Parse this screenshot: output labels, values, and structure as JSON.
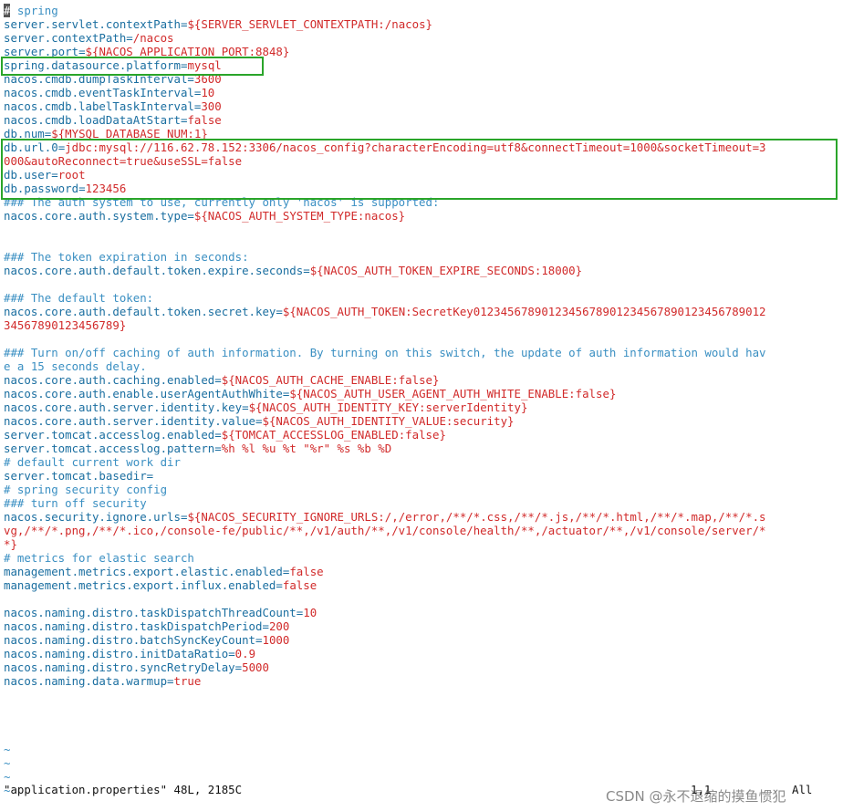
{
  "editor": {
    "lines": [
      [
        {
          "t": "#",
          "c": "cur"
        },
        {
          "t": " spring",
          "c": "c"
        }
      ],
      [
        {
          "t": "server.servlet.contextPath",
          "c": "k"
        },
        {
          "t": "=",
          "c": "k"
        },
        {
          "t": "${SERVER_SERVLET_CONTEXTPATH:/nacos}",
          "c": "v"
        }
      ],
      [
        {
          "t": "server.contextPath",
          "c": "k"
        },
        {
          "t": "=",
          "c": "k"
        },
        {
          "t": "/nacos",
          "c": "v"
        }
      ],
      [
        {
          "t": "server.port",
          "c": "k"
        },
        {
          "t": "=",
          "c": "k"
        },
        {
          "t": "${NACOS_APPLICATION_PORT:8848}",
          "c": "v"
        }
      ],
      [
        {
          "t": "spring.datasource.platform",
          "c": "k"
        },
        {
          "t": "=",
          "c": "k"
        },
        {
          "t": "mysql",
          "c": "v"
        }
      ],
      [
        {
          "t": "nacos.cmdb.dumpTaskInterval",
          "c": "k"
        },
        {
          "t": "=",
          "c": "k"
        },
        {
          "t": "3600",
          "c": "v"
        }
      ],
      [
        {
          "t": "nacos.cmdb.eventTaskInterval",
          "c": "k"
        },
        {
          "t": "=",
          "c": "k"
        },
        {
          "t": "10",
          "c": "v"
        }
      ],
      [
        {
          "t": "nacos.cmdb.labelTaskInterval",
          "c": "k"
        },
        {
          "t": "=",
          "c": "k"
        },
        {
          "t": "300",
          "c": "v"
        }
      ],
      [
        {
          "t": "nacos.cmdb.loadDataAtStart",
          "c": "k"
        },
        {
          "t": "=",
          "c": "k"
        },
        {
          "t": "false",
          "c": "v"
        }
      ],
      [
        {
          "t": "db.num",
          "c": "k"
        },
        {
          "t": "=",
          "c": "k"
        },
        {
          "t": "${MYSQL_DATABASE_NUM:1}",
          "c": "v"
        }
      ],
      [
        {
          "t": "db.url.0",
          "c": "k"
        },
        {
          "t": "=",
          "c": "k"
        },
        {
          "t": "jdbc:mysql://116.62.78.152:3306/nacos_config?characterEncoding=utf8&connectTimeout=1000&socketTimeout=3",
          "c": "v"
        }
      ],
      [
        {
          "t": "000&autoReconnect=true&useSSL=false",
          "c": "v"
        }
      ],
      [
        {
          "t": "db.user",
          "c": "k"
        },
        {
          "t": "=",
          "c": "k"
        },
        {
          "t": "root",
          "c": "v"
        }
      ],
      [
        {
          "t": "db.password",
          "c": "k"
        },
        {
          "t": "=",
          "c": "k"
        },
        {
          "t": "123456",
          "c": "v"
        }
      ],
      [
        {
          "t": "### The auth system to use, currently only 'nacos' is supported:",
          "c": "c"
        }
      ],
      [
        {
          "t": "nacos.core.auth.system.type",
          "c": "k"
        },
        {
          "t": "=",
          "c": "k"
        },
        {
          "t": "${NACOS_AUTH_SYSTEM_TYPE:nacos}",
          "c": "v"
        }
      ],
      [],
      [],
      [
        {
          "t": "### The token expiration in seconds:",
          "c": "c"
        }
      ],
      [
        {
          "t": "nacos.core.auth.default.token.expire.seconds",
          "c": "k"
        },
        {
          "t": "=",
          "c": "k"
        },
        {
          "t": "${NACOS_AUTH_TOKEN_EXPIRE_SECONDS:18000}",
          "c": "v"
        }
      ],
      [],
      [
        {
          "t": "### The default token:",
          "c": "c"
        }
      ],
      [
        {
          "t": "nacos.core.auth.default.token.secret.key",
          "c": "k"
        },
        {
          "t": "=",
          "c": "k"
        },
        {
          "t": "${NACOS_AUTH_TOKEN:SecretKey0123456789012345678901234567890123456789012",
          "c": "v"
        }
      ],
      [
        {
          "t": "34567890123456789}",
          "c": "v"
        }
      ],
      [],
      [
        {
          "t": "### Turn on/off caching of auth information. By turning on this switch, the update of auth information would hav",
          "c": "c"
        }
      ],
      [
        {
          "t": "e a 15 seconds delay.",
          "c": "c"
        }
      ],
      [
        {
          "t": "nacos.core.auth.caching.enabled",
          "c": "k"
        },
        {
          "t": "=",
          "c": "k"
        },
        {
          "t": "${NACOS_AUTH_CACHE_ENABLE:false}",
          "c": "v"
        }
      ],
      [
        {
          "t": "nacos.core.auth.enable.userAgentAuthWhite",
          "c": "k"
        },
        {
          "t": "=",
          "c": "k"
        },
        {
          "t": "${NACOS_AUTH_USER_AGENT_AUTH_WHITE_ENABLE:false}",
          "c": "v"
        }
      ],
      [
        {
          "t": "nacos.core.auth.server.identity.key",
          "c": "k"
        },
        {
          "t": "=",
          "c": "k"
        },
        {
          "t": "${NACOS_AUTH_IDENTITY_KEY:serverIdentity}",
          "c": "v"
        }
      ],
      [
        {
          "t": "nacos.core.auth.server.identity.value",
          "c": "k"
        },
        {
          "t": "=",
          "c": "k"
        },
        {
          "t": "${NACOS_AUTH_IDENTITY_VALUE:security}",
          "c": "v"
        }
      ],
      [
        {
          "t": "server.tomcat.accesslog.enabled",
          "c": "k"
        },
        {
          "t": "=",
          "c": "k"
        },
        {
          "t": "${TOMCAT_ACCESSLOG_ENABLED:false}",
          "c": "v"
        }
      ],
      [
        {
          "t": "server.tomcat.accesslog.pattern",
          "c": "k"
        },
        {
          "t": "=",
          "c": "k"
        },
        {
          "t": "%h %l %u %t \"%r\" %s %b %D",
          "c": "v"
        }
      ],
      [
        {
          "t": "# default current work dir",
          "c": "c"
        }
      ],
      [
        {
          "t": "server.tomcat.basedir",
          "c": "k"
        },
        {
          "t": "=",
          "c": "k"
        }
      ],
      [
        {
          "t": "# spring security config",
          "c": "c"
        }
      ],
      [
        {
          "t": "### turn off security",
          "c": "c"
        }
      ],
      [
        {
          "t": "nacos.security.ignore.urls",
          "c": "k"
        },
        {
          "t": "=",
          "c": "k"
        },
        {
          "t": "${NACOS_SECURITY_IGNORE_URLS:/,/error,/**/*.css,/**/*.js,/**/*.html,/**/*.map,/**/*.s",
          "c": "v"
        }
      ],
      [
        {
          "t": "vg,/**/*.png,/**/*.ico,/console-fe/public/**,/v1/auth/**,/v1/console/health/**,/actuator/**,/v1/console/server/*",
          "c": "v"
        }
      ],
      [
        {
          "t": "*}",
          "c": "v"
        }
      ],
      [
        {
          "t": "# metrics for elastic search",
          "c": "c"
        }
      ],
      [
        {
          "t": "management.metrics.export.elastic.enabled",
          "c": "k"
        },
        {
          "t": "=",
          "c": "k"
        },
        {
          "t": "false",
          "c": "v"
        }
      ],
      [
        {
          "t": "management.metrics.export.influx.enabled",
          "c": "k"
        },
        {
          "t": "=",
          "c": "k"
        },
        {
          "t": "false",
          "c": "v"
        }
      ],
      [],
      [
        {
          "t": "nacos.naming.distro.taskDispatchThreadCount",
          "c": "k"
        },
        {
          "t": "=",
          "c": "k"
        },
        {
          "t": "10",
          "c": "v"
        }
      ],
      [
        {
          "t": "nacos.naming.distro.taskDispatchPeriod",
          "c": "k"
        },
        {
          "t": "=",
          "c": "k"
        },
        {
          "t": "200",
          "c": "v"
        }
      ],
      [
        {
          "t": "nacos.naming.distro.batchSyncKeyCount",
          "c": "k"
        },
        {
          "t": "=",
          "c": "k"
        },
        {
          "t": "1000",
          "c": "v"
        }
      ],
      [
        {
          "t": "nacos.naming.distro.initDataRatio",
          "c": "k"
        },
        {
          "t": "=",
          "c": "k"
        },
        {
          "t": "0.9",
          "c": "v"
        }
      ],
      [
        {
          "t": "nacos.naming.distro.syncRetryDelay",
          "c": "k"
        },
        {
          "t": "=",
          "c": "k"
        },
        {
          "t": "5000",
          "c": "v"
        }
      ],
      [
        {
          "t": "nacos.naming.data.warmup",
          "c": "k"
        },
        {
          "t": "=",
          "c": "k"
        },
        {
          "t": "true",
          "c": "v"
        }
      ],
      [],
      [],
      [],
      [],
      [
        {
          "t": "~",
          "c": "c"
        }
      ],
      [
        {
          "t": "~",
          "c": "c"
        }
      ],
      [
        {
          "t": "~",
          "c": "c"
        }
      ],
      [
        {
          "t": "~",
          "c": "c"
        }
      ]
    ]
  },
  "status_bar": {
    "file_info": "\"application.properties\" 48L, 2185C",
    "cursor_position": "1,1",
    "scroll": "All"
  },
  "watermark": "CSDN @永不退缩的摸鱼惯犯",
  "colors": {
    "key": "#1a6ea0",
    "value": "#d12a2a",
    "comment": "#3a8fc2",
    "highlight_box": "#2aa52a"
  }
}
